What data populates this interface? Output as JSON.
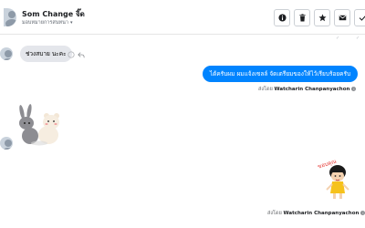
{
  "header": {
    "contact_name": "Som Change จิ๊ด",
    "contact_sub": "มอบหมายการสนทนา",
    "toolbar": [
      {
        "name": "info-button",
        "icon": "info-icon"
      },
      {
        "name": "delete-button",
        "icon": "trash-icon"
      },
      {
        "name": "star-button",
        "icon": "star-icon"
      },
      {
        "name": "mail-button",
        "icon": "mail-icon"
      },
      {
        "name": "done-button",
        "icon": "check-icon"
      }
    ]
  },
  "messages": {
    "incoming_text": "ช่วงสบาย นะคะ",
    "outgoing_text": "ได้ครับผม ผมแจ้งเซลล์ จัดเตรียมของให้ไว้เรียบร้อยครับ",
    "sent_by_label": "ส่งโดย",
    "sender_name": "Watcharin Chanpanyachon",
    "sticker_text": "ขอบคุณ"
  },
  "colors": {
    "accent": "#0084ff",
    "incoming_bubble": "#e4e6eb"
  }
}
